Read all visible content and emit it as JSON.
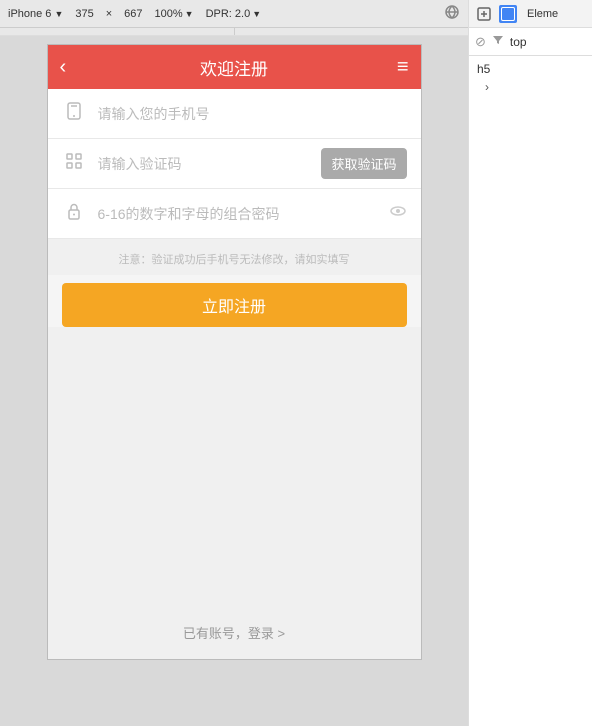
{
  "toolbar": {
    "device": "iPhone 6",
    "width": "375",
    "x": "×",
    "height": "667",
    "zoom": "100%",
    "dpr_label": "DPR: 2.0"
  },
  "devtools": {
    "tabs": [
      {
        "label": "Elements",
        "active": false
      }
    ],
    "filter_icon_label": "no-entry-icon",
    "filter_icon2_label": "funnel-icon",
    "filter_text": "top",
    "elements": [
      {
        "tag": "h5"
      }
    ],
    "arrow": "›"
  },
  "app": {
    "header": {
      "back_label": "‹",
      "title": "欢迎注册",
      "menu_label": "≡"
    },
    "phone_field": {
      "placeholder": "请输入您的手机号",
      "icon": "phone"
    },
    "verify_field": {
      "placeholder": "请输入验证码",
      "button_label": "获取验证码",
      "icon": "grid"
    },
    "password_field": {
      "placeholder": "6-16的数字和字母的组合密码",
      "icon": "lock",
      "eye_icon": "eye"
    },
    "notice": "注意：验证成功后手机号无法修改，请如实填写",
    "register_btn": "立即注册",
    "login_link": "已有账号，登录 >"
  }
}
